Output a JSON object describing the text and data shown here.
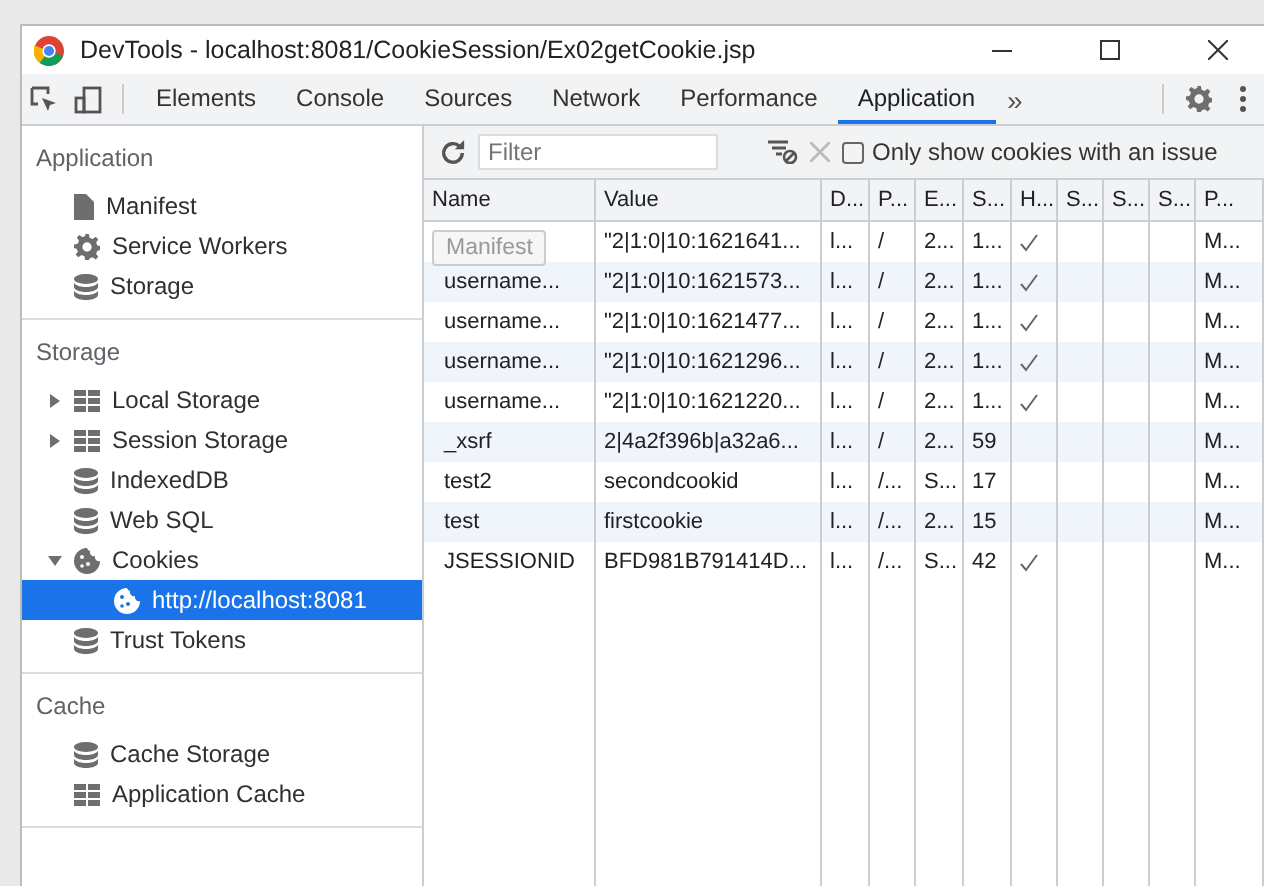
{
  "title_bar": {
    "title": "DevTools - localhost:8081/CookieSession/Ex02getCookie.jsp"
  },
  "tabs": [
    {
      "label": "Elements",
      "selected": false
    },
    {
      "label": "Console",
      "selected": false
    },
    {
      "label": "Sources",
      "selected": false
    },
    {
      "label": "Network",
      "selected": false
    },
    {
      "label": "Performance",
      "selected": false
    },
    {
      "label": "Application",
      "selected": true
    }
  ],
  "more_tabs": "»",
  "sidebar": {
    "sections": [
      {
        "title": "Application",
        "items": [
          {
            "label": "Manifest",
            "kind": "file",
            "selected": false
          },
          {
            "label": "Service Workers",
            "kind": "gear",
            "selected": false
          },
          {
            "label": "Storage",
            "kind": "db",
            "selected": false
          }
        ]
      },
      {
        "title": "Storage",
        "items": [
          {
            "label": "Local Storage",
            "kind": "grid",
            "expanded": false,
            "selected": false
          },
          {
            "label": "Session Storage",
            "kind": "grid",
            "expanded": false,
            "selected": false
          },
          {
            "label": "IndexedDB",
            "kind": "db",
            "selected": false
          },
          {
            "label": "Web SQL",
            "kind": "db",
            "selected": false
          },
          {
            "label": "Cookies",
            "kind": "cookie",
            "expanded": true,
            "selected": false,
            "children": [
              {
                "label": "http://localhost:8081",
                "kind": "cookie",
                "selected": true
              }
            ]
          },
          {
            "label": "Trust Tokens",
            "kind": "db",
            "selected": false
          }
        ]
      },
      {
        "title": "Cache",
        "items": [
          {
            "label": "Cache Storage",
            "kind": "db",
            "selected": false
          },
          {
            "label": "Application Cache",
            "kind": "grid",
            "selected": false
          }
        ]
      }
    ]
  },
  "toolbar": {
    "filter": {
      "placeholder": "Filter"
    },
    "issue_filter": {
      "label": "Only show cookies with an issue",
      "checked": false
    }
  },
  "table": {
    "columns": [
      "Name",
      "Value",
      "D...",
      "P...",
      "E...",
      "S...",
      "H...",
      "S...",
      "S...",
      "S...",
      "P..."
    ],
    "rows": [
      {
        "value": "\"2|1:0|10:1621641...",
        "domain": "l...",
        "path": "/",
        "expires": "2...",
        "size": "1...",
        "http_only": true,
        "priority": "M..."
      },
      {
        "name": "username...",
        "value": "\"2|1:0|10:1621573...",
        "domain": "l...",
        "path": "/",
        "expires": "2...",
        "size": "1...",
        "http_only": true,
        "priority": "M..."
      },
      {
        "name": "username...",
        "value": "\"2|1:0|10:1621477...",
        "domain": "l...",
        "path": "/",
        "expires": "2...",
        "size": "1...",
        "http_only": true,
        "priority": "M..."
      },
      {
        "name": "username...",
        "value": "\"2|1:0|10:1621296...",
        "domain": "l...",
        "path": "/",
        "expires": "2...",
        "size": "1...",
        "http_only": true,
        "priority": "M..."
      },
      {
        "name": "username...",
        "value": "\"2|1:0|10:1621220...",
        "domain": "l...",
        "path": "/",
        "expires": "2...",
        "size": "1...",
        "http_only": true,
        "priority": "M..."
      },
      {
        "name": "_xsrf",
        "value": "2|4a2f396b|a32a6...",
        "domain": "l...",
        "path": "/",
        "expires": "2...",
        "size": "59",
        "http_only": false,
        "priority": "M..."
      },
      {
        "name": "test2",
        "value": "secondcookid",
        "domain": "l...",
        "path": "/...",
        "expires": "S...",
        "size": "17",
        "http_only": false,
        "priority": "M..."
      },
      {
        "name": "test",
        "value": "firstcookie",
        "domain": "l...",
        "path": "/...",
        "expires": "2...",
        "size": "15",
        "http_only": false,
        "priority": "M..."
      },
      {
        "name": "JSESSIONID",
        "value": "BFD981B791414D...",
        "domain": "l...",
        "path": "/...",
        "expires": "S...",
        "size": "42",
        "http_only": true,
        "priority": "M..."
      }
    ]
  },
  "drag_ghost": "Manifest"
}
